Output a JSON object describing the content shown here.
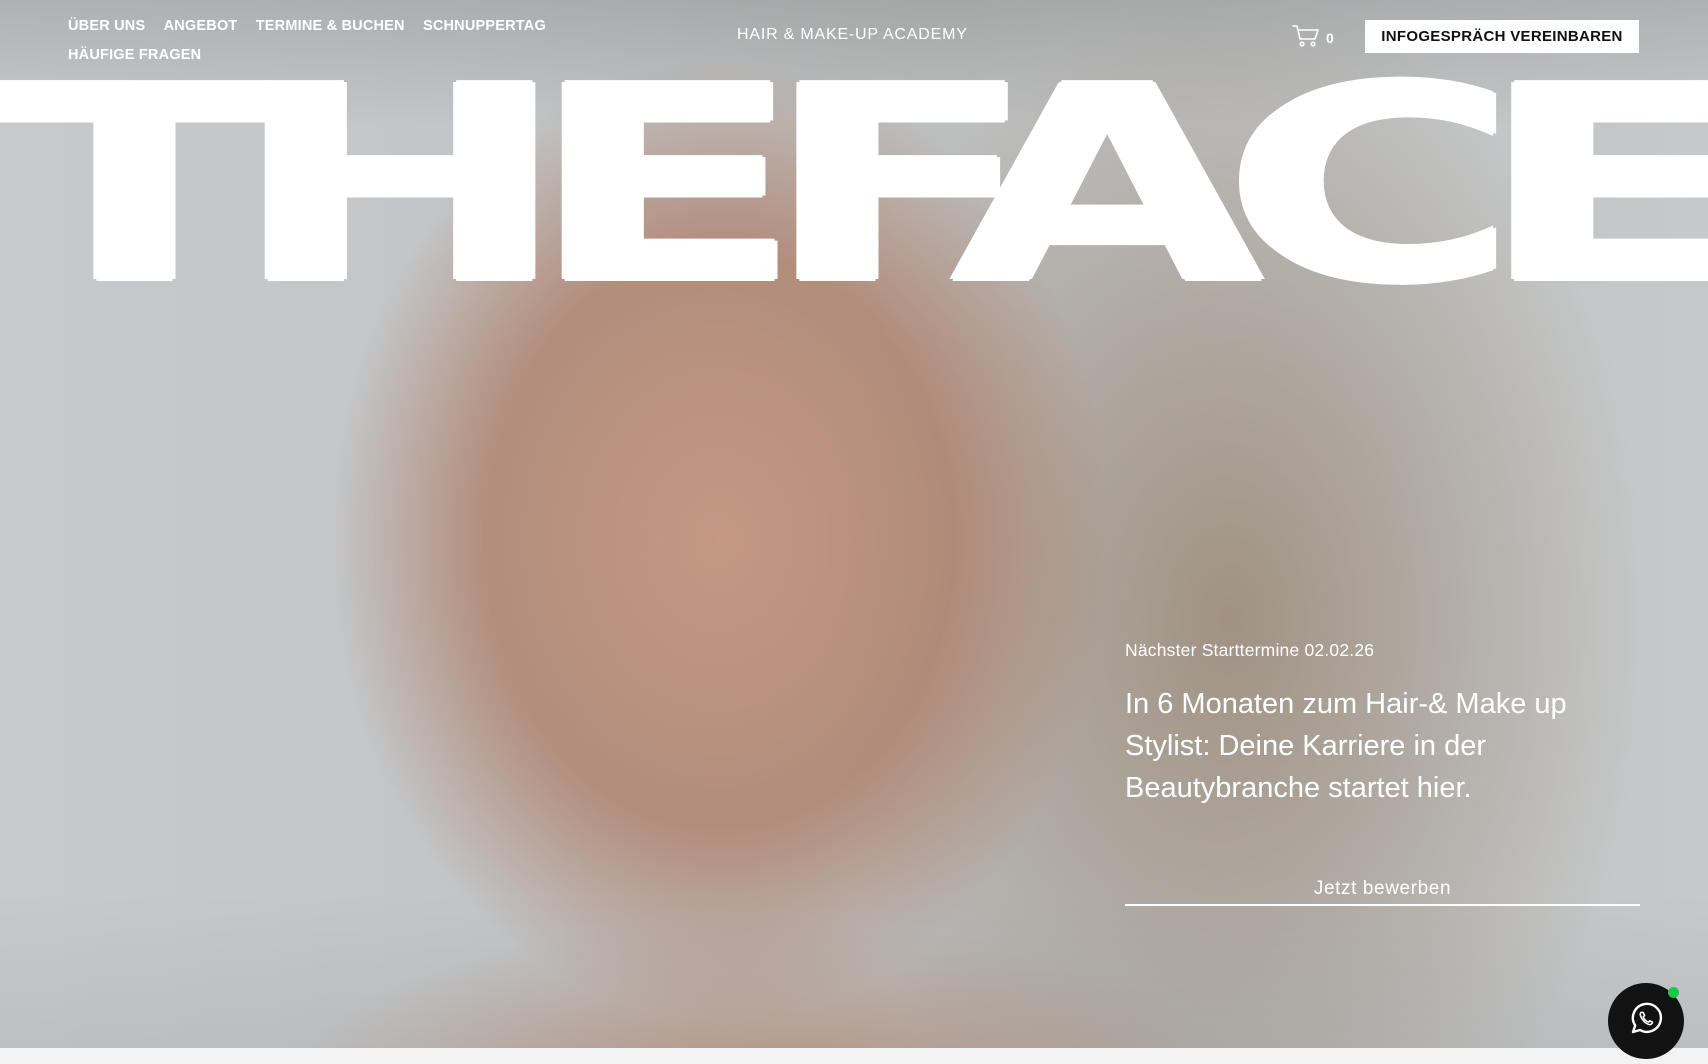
{
  "nav": {
    "items": [
      {
        "label": "ÜBER UNS"
      },
      {
        "label": "ANGEBOT"
      },
      {
        "label": "TERMINE & BUCHEN"
      },
      {
        "label": "SCHNUPPERTAG"
      },
      {
        "label": "HÄUFIGE FRAGEN"
      }
    ]
  },
  "header": {
    "site_tag": "HAIR & MAKE-UP ACADEMY",
    "cart_count": "0",
    "cta_label": "INFOGESPRÄCH VEREINBAREN"
  },
  "hero": {
    "headline": "THEFACE",
    "next_date": "Nächster Starttermine 02.02.26",
    "tagline": "In 6 Monaten zum Hair-& Make up Stylist: Deine Karriere in der Beautybranche startet hier.",
    "apply_label": "Jetzt bewerben"
  },
  "icons": {
    "cart": "cart-icon",
    "whatsapp": "whatsapp-icon"
  },
  "colors": {
    "online_indicator": "#18c94a",
    "chat_button": "#121212"
  }
}
